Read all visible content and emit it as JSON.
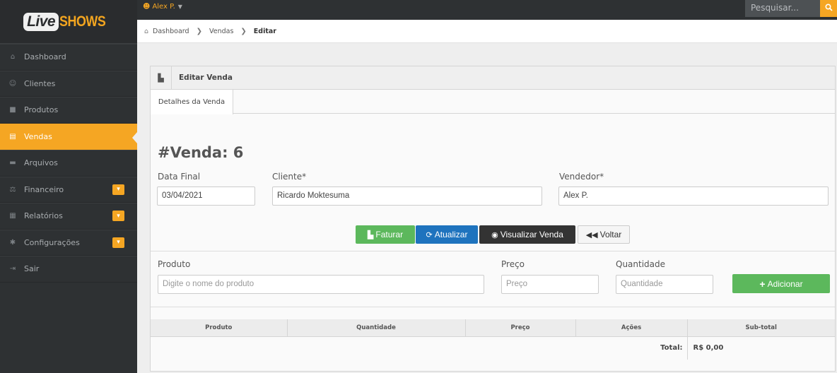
{
  "brand": {
    "part1": "Live",
    "part2": "SHOWS"
  },
  "topbar": {
    "user": "Alex P.",
    "caret": "▼",
    "search_placeholder": "Pesquisar...",
    "search_icon": "search-icon"
  },
  "breadcrumb": {
    "home": "Dashboard",
    "section": "Vendas",
    "current": "Editar",
    "sep": "❯"
  },
  "sidebar": {
    "items": [
      {
        "label": "Dashboard",
        "icon": "home-icon",
        "glyph": "⌂"
      },
      {
        "label": "Clientes",
        "icon": "users-icon",
        "glyph": "☺"
      },
      {
        "label": "Produtos",
        "icon": "box-icon",
        "glyph": "■"
      },
      {
        "label": "Vendas",
        "icon": "cart-icon",
        "glyph": "▤",
        "active": true
      },
      {
        "label": "Arquivos",
        "icon": "hdd-icon",
        "glyph": "▬"
      },
      {
        "label": "Financeiro",
        "icon": "money-icon",
        "glyph": "⚖",
        "badge": true
      },
      {
        "label": "Relatórios",
        "icon": "list-icon",
        "glyph": "▦",
        "badge": true
      },
      {
        "label": "Configurações",
        "icon": "gear-icon",
        "glyph": "✱",
        "badge": true
      },
      {
        "label": "Sair",
        "icon": "signout-icon",
        "glyph": "⇥"
      }
    ],
    "badge_glyph": "▾"
  },
  "widget": {
    "title": "Editar Venda",
    "tab": "Detalhes da Venda",
    "venda_title": "#Venda: 6",
    "fields": {
      "data_final_label": "Data Final",
      "data_final_value": "03/04/2021",
      "cliente_label": "Cliente*",
      "cliente_value": "Ricardo Moktesuma",
      "vendedor_label": "Vendedor*",
      "vendedor_value": "Alex P."
    },
    "buttons": {
      "faturar": "Faturar",
      "atualizar": "Atualizar",
      "visualizar": "Visualizar Venda",
      "voltar": "Voltar",
      "adicionar": "Adicionar"
    },
    "produto_form": {
      "produto_label": "Produto",
      "produto_placeholder": "Digite o nome do produto",
      "preco_label": "Preço",
      "preco_placeholder": "Preço",
      "quantidade_label": "Quantidade",
      "quantidade_placeholder": "Quantidade"
    },
    "table": {
      "headers": [
        "Produto",
        "Quantidade",
        "Preço",
        "Ações",
        "Sub-total"
      ],
      "total_label": "Total:",
      "total_value": "R$ 0,00"
    }
  }
}
